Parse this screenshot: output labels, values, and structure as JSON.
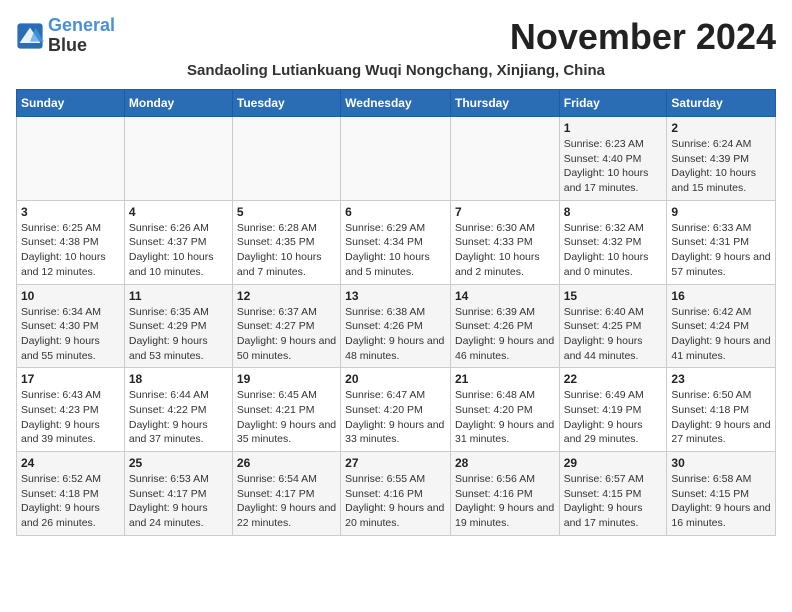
{
  "header": {
    "logo_line1": "General",
    "logo_line2": "Blue",
    "month_title": "November 2024",
    "location": "Sandaoling Lutiankuang Wuqi Nongchang, Xinjiang, China"
  },
  "weekdays": [
    "Sunday",
    "Monday",
    "Tuesday",
    "Wednesday",
    "Thursday",
    "Friday",
    "Saturday"
  ],
  "weeks": [
    [
      {
        "day": "",
        "info": ""
      },
      {
        "day": "",
        "info": ""
      },
      {
        "day": "",
        "info": ""
      },
      {
        "day": "",
        "info": ""
      },
      {
        "day": "",
        "info": ""
      },
      {
        "day": "1",
        "info": "Sunrise: 6:23 AM\nSunset: 4:40 PM\nDaylight: 10 hours and 17 minutes."
      },
      {
        "day": "2",
        "info": "Sunrise: 6:24 AM\nSunset: 4:39 PM\nDaylight: 10 hours and 15 minutes."
      }
    ],
    [
      {
        "day": "3",
        "info": "Sunrise: 6:25 AM\nSunset: 4:38 PM\nDaylight: 10 hours and 12 minutes."
      },
      {
        "day": "4",
        "info": "Sunrise: 6:26 AM\nSunset: 4:37 PM\nDaylight: 10 hours and 10 minutes."
      },
      {
        "day": "5",
        "info": "Sunrise: 6:28 AM\nSunset: 4:35 PM\nDaylight: 10 hours and 7 minutes."
      },
      {
        "day": "6",
        "info": "Sunrise: 6:29 AM\nSunset: 4:34 PM\nDaylight: 10 hours and 5 minutes."
      },
      {
        "day": "7",
        "info": "Sunrise: 6:30 AM\nSunset: 4:33 PM\nDaylight: 10 hours and 2 minutes."
      },
      {
        "day": "8",
        "info": "Sunrise: 6:32 AM\nSunset: 4:32 PM\nDaylight: 10 hours and 0 minutes."
      },
      {
        "day": "9",
        "info": "Sunrise: 6:33 AM\nSunset: 4:31 PM\nDaylight: 9 hours and 57 minutes."
      }
    ],
    [
      {
        "day": "10",
        "info": "Sunrise: 6:34 AM\nSunset: 4:30 PM\nDaylight: 9 hours and 55 minutes."
      },
      {
        "day": "11",
        "info": "Sunrise: 6:35 AM\nSunset: 4:29 PM\nDaylight: 9 hours and 53 minutes."
      },
      {
        "day": "12",
        "info": "Sunrise: 6:37 AM\nSunset: 4:27 PM\nDaylight: 9 hours and 50 minutes."
      },
      {
        "day": "13",
        "info": "Sunrise: 6:38 AM\nSunset: 4:26 PM\nDaylight: 9 hours and 48 minutes."
      },
      {
        "day": "14",
        "info": "Sunrise: 6:39 AM\nSunset: 4:26 PM\nDaylight: 9 hours and 46 minutes."
      },
      {
        "day": "15",
        "info": "Sunrise: 6:40 AM\nSunset: 4:25 PM\nDaylight: 9 hours and 44 minutes."
      },
      {
        "day": "16",
        "info": "Sunrise: 6:42 AM\nSunset: 4:24 PM\nDaylight: 9 hours and 41 minutes."
      }
    ],
    [
      {
        "day": "17",
        "info": "Sunrise: 6:43 AM\nSunset: 4:23 PM\nDaylight: 9 hours and 39 minutes."
      },
      {
        "day": "18",
        "info": "Sunrise: 6:44 AM\nSunset: 4:22 PM\nDaylight: 9 hours and 37 minutes."
      },
      {
        "day": "19",
        "info": "Sunrise: 6:45 AM\nSunset: 4:21 PM\nDaylight: 9 hours and 35 minutes."
      },
      {
        "day": "20",
        "info": "Sunrise: 6:47 AM\nSunset: 4:20 PM\nDaylight: 9 hours and 33 minutes."
      },
      {
        "day": "21",
        "info": "Sunrise: 6:48 AM\nSunset: 4:20 PM\nDaylight: 9 hours and 31 minutes."
      },
      {
        "day": "22",
        "info": "Sunrise: 6:49 AM\nSunset: 4:19 PM\nDaylight: 9 hours and 29 minutes."
      },
      {
        "day": "23",
        "info": "Sunrise: 6:50 AM\nSunset: 4:18 PM\nDaylight: 9 hours and 27 minutes."
      }
    ],
    [
      {
        "day": "24",
        "info": "Sunrise: 6:52 AM\nSunset: 4:18 PM\nDaylight: 9 hours and 26 minutes."
      },
      {
        "day": "25",
        "info": "Sunrise: 6:53 AM\nSunset: 4:17 PM\nDaylight: 9 hours and 24 minutes."
      },
      {
        "day": "26",
        "info": "Sunrise: 6:54 AM\nSunset: 4:17 PM\nDaylight: 9 hours and 22 minutes."
      },
      {
        "day": "27",
        "info": "Sunrise: 6:55 AM\nSunset: 4:16 PM\nDaylight: 9 hours and 20 minutes."
      },
      {
        "day": "28",
        "info": "Sunrise: 6:56 AM\nSunset: 4:16 PM\nDaylight: 9 hours and 19 minutes."
      },
      {
        "day": "29",
        "info": "Sunrise: 6:57 AM\nSunset: 4:15 PM\nDaylight: 9 hours and 17 minutes."
      },
      {
        "day": "30",
        "info": "Sunrise: 6:58 AM\nSunset: 4:15 PM\nDaylight: 9 hours and 16 minutes."
      }
    ]
  ]
}
